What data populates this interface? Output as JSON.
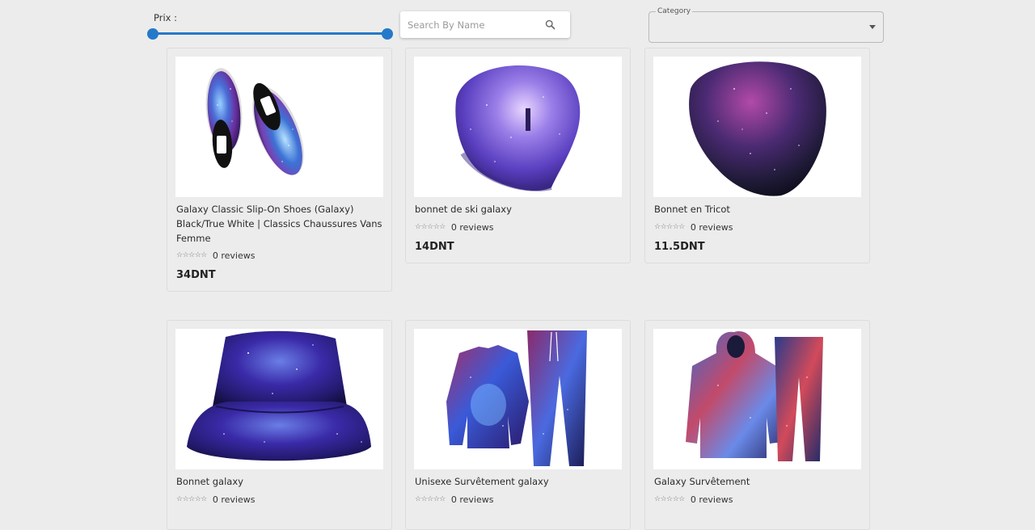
{
  "filters": {
    "price_label": "Prix :",
    "search_placeholder": "Search By Name",
    "search_value": "",
    "category_label": "Category",
    "category_value": ""
  },
  "products": [
    {
      "title": "Galaxy Classic Slip-On Shoes (Galaxy) Black/True White | Classics Chaussures Vans Femme",
      "stars": "☆☆☆☆☆",
      "reviews": "0 reviews",
      "price": "34DNT",
      "image": "galaxy-slip-on-shoes"
    },
    {
      "title": "bonnet de ski galaxy",
      "stars": "☆☆☆☆☆",
      "reviews": "0 reviews",
      "price": "14DNT",
      "image": "galaxy-ski-beanie"
    },
    {
      "title": "Bonnet en Tricot",
      "stars": "☆☆☆☆☆",
      "reviews": "0 reviews",
      "price": "11.5DNT",
      "image": "galaxy-knit-beanie"
    },
    {
      "title": "Bonnet galaxy",
      "stars": "☆☆☆☆☆",
      "reviews": "0 reviews",
      "price": "",
      "image": "galaxy-bucket-hat"
    },
    {
      "title": "Unisexe Survêtement galaxy",
      "stars": "☆☆☆☆☆",
      "reviews": "0 reviews",
      "price": "",
      "image": "wolf-galaxy-tracksuit"
    },
    {
      "title": "Galaxy Survêtement",
      "stars": "☆☆☆☆☆",
      "reviews": "0 reviews",
      "price": "",
      "image": "galaxy-hoodie-tracksuit"
    }
  ],
  "colors": {
    "accent": "#2479c9",
    "background": "#ececec"
  }
}
